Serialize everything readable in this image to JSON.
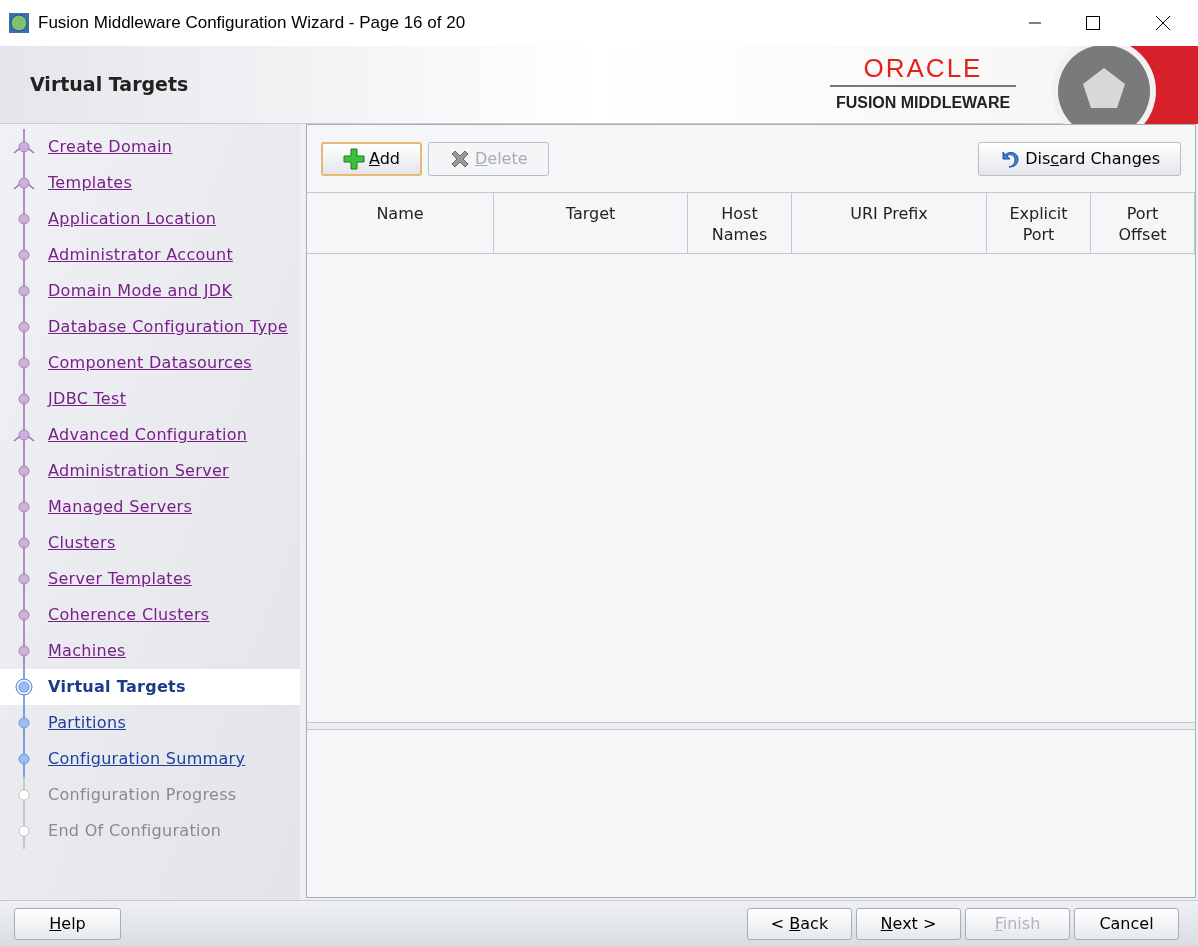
{
  "window": {
    "title": "Fusion Middleware Configuration Wizard - Page 16 of 20"
  },
  "header": {
    "title": "Virtual Targets",
    "logo_top": "ORACLE",
    "logo_bottom": "FUSION MIDDLEWARE"
  },
  "steps": [
    {
      "label": "Create Domain",
      "completed": true,
      "selected": false,
      "disabled": false,
      "fork": true
    },
    {
      "label": "Templates",
      "completed": true,
      "selected": false,
      "disabled": false,
      "fork": true
    },
    {
      "label": "Application Location",
      "completed": true,
      "selected": false,
      "disabled": false,
      "fork": false
    },
    {
      "label": "Administrator Account",
      "completed": true,
      "selected": false,
      "disabled": false,
      "fork": false
    },
    {
      "label": "Domain Mode and JDK",
      "completed": true,
      "selected": false,
      "disabled": false,
      "fork": false
    },
    {
      "label": "Database Configuration Type",
      "completed": true,
      "selected": false,
      "disabled": false,
      "fork": false
    },
    {
      "label": "Component Datasources",
      "completed": true,
      "selected": false,
      "disabled": false,
      "fork": false
    },
    {
      "label": "JDBC Test",
      "completed": true,
      "selected": false,
      "disabled": false,
      "fork": false
    },
    {
      "label": "Advanced Configuration",
      "completed": true,
      "selected": false,
      "disabled": false,
      "fork": true
    },
    {
      "label": "Administration Server",
      "completed": true,
      "selected": false,
      "disabled": false,
      "fork": false
    },
    {
      "label": "Managed Servers",
      "completed": true,
      "selected": false,
      "disabled": false,
      "fork": false
    },
    {
      "label": "Clusters",
      "completed": true,
      "selected": false,
      "disabled": false,
      "fork": false
    },
    {
      "label": "Server Templates",
      "completed": true,
      "selected": false,
      "disabled": false,
      "fork": false
    },
    {
      "label": "Coherence Clusters",
      "completed": true,
      "selected": false,
      "disabled": false,
      "fork": false
    },
    {
      "label": "Machines",
      "completed": true,
      "selected": false,
      "disabled": false,
      "fork": false
    },
    {
      "label": "Virtual Targets",
      "completed": false,
      "selected": true,
      "disabled": false,
      "fork": false
    },
    {
      "label": "Partitions",
      "completed": false,
      "selected": false,
      "disabled": false,
      "fork": false
    },
    {
      "label": "Configuration Summary",
      "completed": false,
      "selected": false,
      "disabled": false,
      "fork": false
    },
    {
      "label": "Configuration Progress",
      "completed": false,
      "selected": false,
      "disabled": true,
      "fork": false
    },
    {
      "label": "End Of Configuration",
      "completed": false,
      "selected": false,
      "disabled": true,
      "fork": false
    }
  ],
  "toolbar": [
    {
      "kind": "add",
      "key": "A",
      "after": "dd",
      "disabled": false,
      "focused": true
    },
    {
      "kind": "delete",
      "key": "D",
      "after": "elete",
      "disabled": true,
      "focused": false
    },
    {
      "kind": "discard",
      "before": "Dis",
      "key": "c",
      "after": "ard Changes",
      "disabled": false,
      "focused": false
    }
  ],
  "table": {
    "columns": [
      {
        "lines": [
          "Name"
        ]
      },
      {
        "lines": [
          "Target"
        ]
      },
      {
        "lines": [
          "Host",
          "Names"
        ]
      },
      {
        "lines": [
          "URI Prefix"
        ]
      },
      {
        "lines": [
          "Explicit",
          "Port"
        ]
      },
      {
        "lines": [
          "Port",
          "Offset"
        ]
      }
    ]
  },
  "footer": {
    "left": [
      {
        "key": "H",
        "after": "elp",
        "disabled": false
      }
    ],
    "right": [
      {
        "before": "< ",
        "key": "B",
        "after": "ack",
        "disabled": false
      },
      {
        "key": "N",
        "after": "ext >",
        "disabled": false
      },
      {
        "key": "F",
        "after": "inish",
        "disabled": true
      },
      {
        "before": "Cancel",
        "disabled": false
      }
    ]
  }
}
